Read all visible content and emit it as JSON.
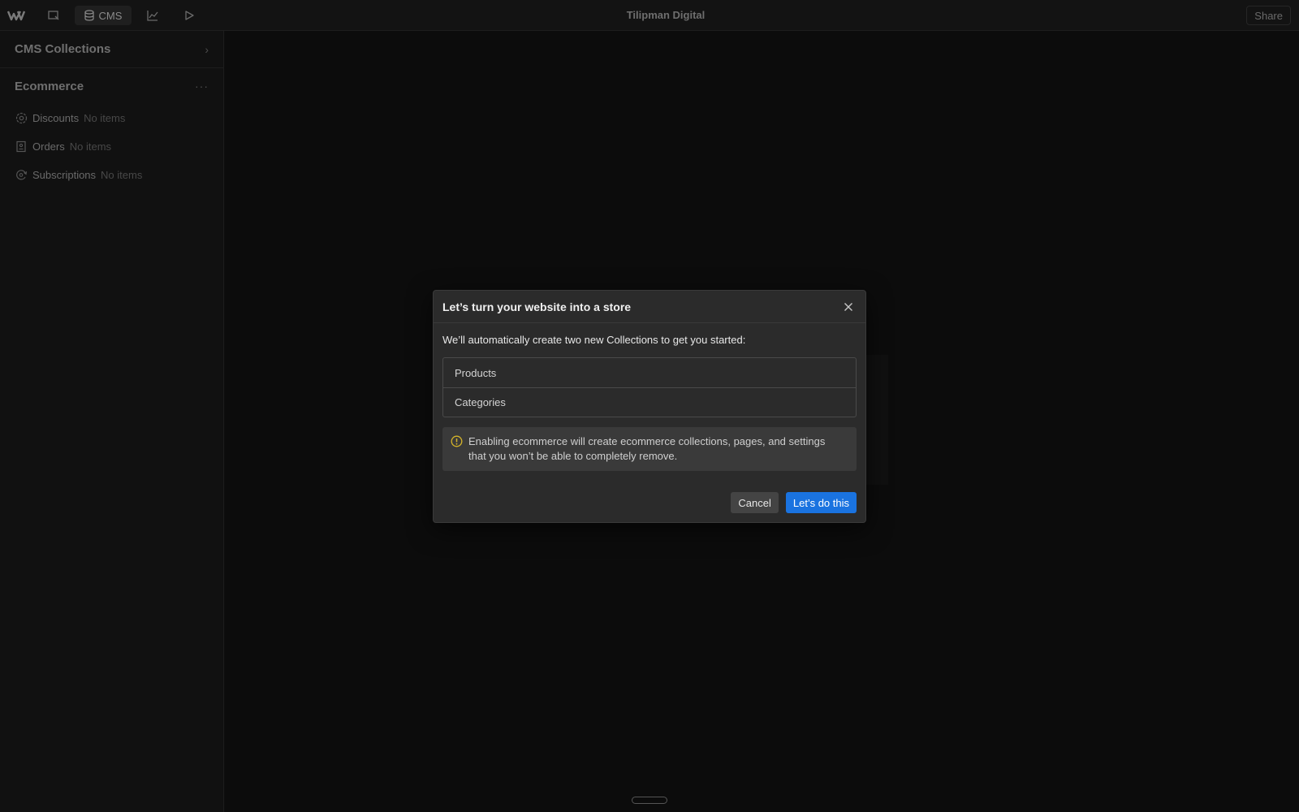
{
  "topbar": {
    "cms_label": "CMS",
    "site_title": "Tilipman Digital",
    "share_label": "Share"
  },
  "sidebar": {
    "collections_title": "CMS Collections",
    "ecommerce_title": "Ecommerce",
    "items": [
      {
        "label": "Discounts",
        "count": "No items",
        "icon": "discount-icon"
      },
      {
        "label": "Orders",
        "count": "No items",
        "icon": "orders-icon"
      },
      {
        "label": "Subscriptions",
        "count": "No items",
        "icon": "subscriptions-icon"
      }
    ]
  },
  "modal": {
    "title": "Let’s turn your website into a store",
    "description": "We’ll automatically create two new Collections to get you started:",
    "collections": [
      "Products",
      "Categories"
    ],
    "warning_line1": "Enabling ecommerce will create ecommerce collections, pages, and settings",
    "warning_line2": "that you won’t be able to completely remove.",
    "cancel_label": "Cancel",
    "confirm_label": "Let’s do this",
    "accent_color": "#1a73e0",
    "warning_color": "#d6b52a"
  }
}
